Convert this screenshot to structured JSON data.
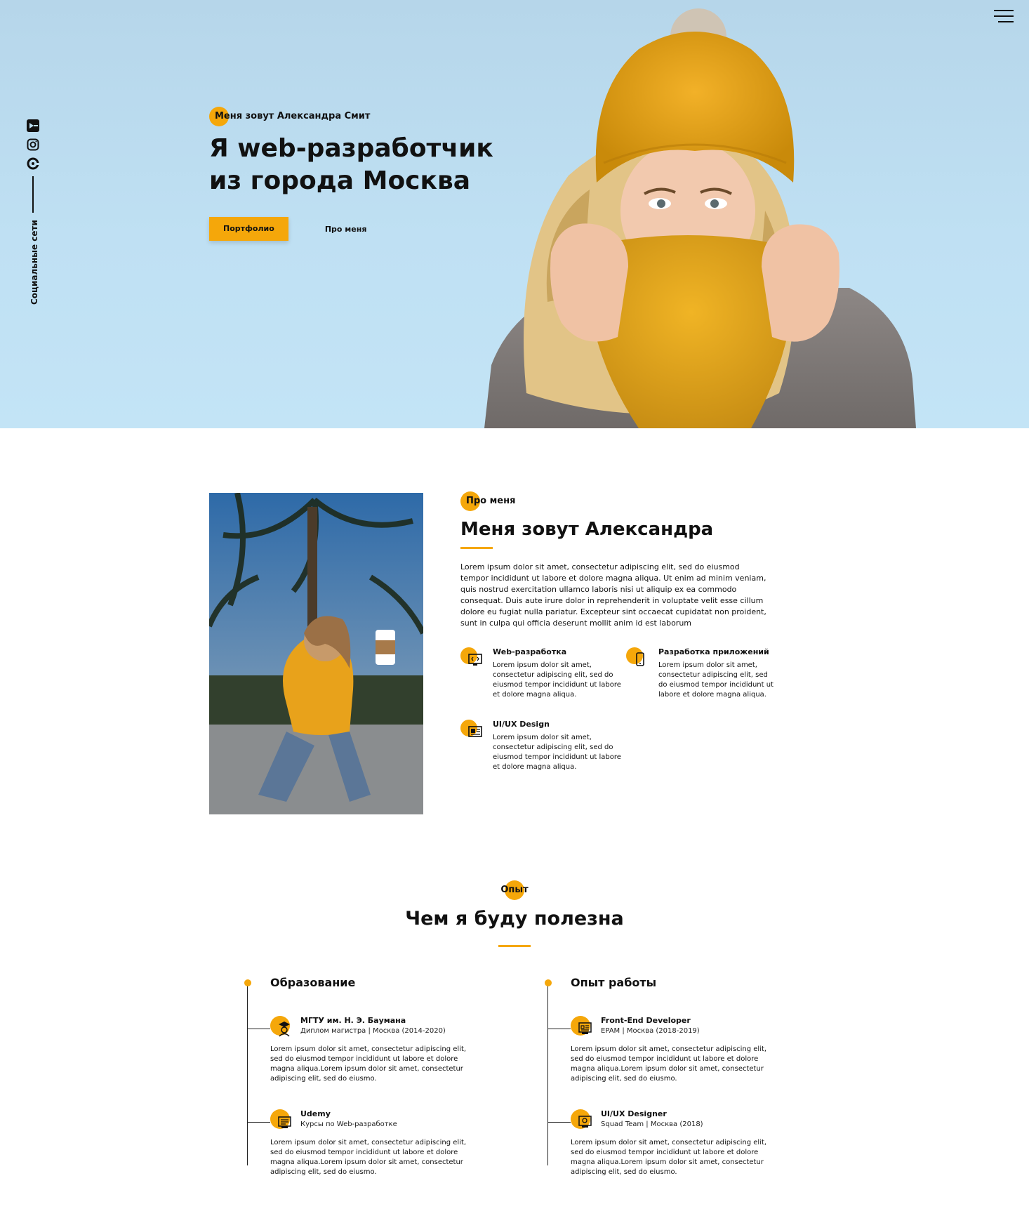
{
  "colors": {
    "accent": "#f5a70a",
    "hero_bg": "#bfe0f3",
    "text": "#111111"
  },
  "hero": {
    "kicker": "Меня зовут Александра Смит",
    "title_line1": "Я web-разработчик",
    "title_line2": "из города Москва",
    "btn_portfolio": "Портфолио",
    "btn_about": "Про меня",
    "social_label": "Социальные сети",
    "social_icons": [
      "youtube-icon",
      "instagram-icon",
      "github-icon"
    ],
    "menu_icon": "hamburger-menu-icon"
  },
  "about": {
    "kicker": "Про меня",
    "title": "Меня зовут Александра",
    "text": "Lorem ipsum dolor sit amet, consectetur adipiscing elit, sed do eiusmod tempor incididunt ut labore et dolore magna aliqua. Ut enim ad minim veniam, quis nostrud exercitation ullamco laboris nisi ut aliquip ex ea commodo consequat. Duis aute irure dolor in reprehenderit in voluptate velit esse cillum dolore eu fugiat nulla pariatur. Excepteur sint occaecat cupidatat non proident, sunt in culpa qui officia deserunt mollit anim id est laborum",
    "services": [
      {
        "title": "Web-разработка",
        "text": "Lorem ipsum dolor sit amet, consectetur adipiscing elit, sed do eiusmod tempor incididunt ut labore et dolore magna aliqua.",
        "icon": "monitor-code-icon"
      },
      {
        "title": "Разработка приложений",
        "text": "Lorem ipsum dolor sit amet, consectetur adipiscing elit, sed do eiusmod tempor incididunt ut labore et dolore magna aliqua.",
        "icon": "smartphone-icon"
      },
      {
        "title": "UI/UX Design",
        "text": "Lorem ipsum dolor sit amet, consectetur adipiscing elit, sed do eiusmod tempor incididunt ut labore et dolore magna aliqua.",
        "icon": "design-icon"
      }
    ]
  },
  "experience": {
    "kicker": "Опыт",
    "title": "Чем я буду полезна",
    "education": {
      "title": "Образование",
      "items": [
        {
          "title": "МГТУ им. Н. Э. Баумана",
          "sub": "Диплом магистра | Москва (2014-2020)",
          "text": "Lorem ipsum dolor sit amet, consectetur adipiscing elit, sed do eiusmod tempor incididunt ut labore et dolore magna aliqua.Lorem ipsum dolor sit amet, consectetur adipiscing elit, sed do eiusmo.",
          "icon": "graduate-icon"
        },
        {
          "title": "Udemy",
          "sub": "Курсы по Web-разработке",
          "text": "Lorem ipsum dolor sit amet, consectetur adipiscing elit, sed do eiusmod tempor incididunt ut labore et dolore magna aliqua.Lorem ipsum dolor sit amet, consectetur adipiscing elit, sed do eiusmo.",
          "icon": "online-course-icon"
        }
      ]
    },
    "work": {
      "title": "Опыт работы",
      "items": [
        {
          "title": "Front-End Developer",
          "sub": "EPAM | Москва (2018-2019)",
          "text": "Lorem ipsum dolor sit amet, consectetur adipiscing elit, sed do eiusmod tempor incididunt ut labore et dolore magna aliqua.Lorem ipsum dolor sit amet, consectetur adipiscing elit, sed do eiusmo.",
          "icon": "developer-icon"
        },
        {
          "title": "UI/UX Designer",
          "sub": "Squad Team | Москва (2018)",
          "text": "Lorem ipsum dolor sit amet, consectetur adipiscing elit, sed do eiusmod tempor incididunt ut labore et dolore magna aliqua.Lorem ipsum dolor sit amet, consectetur adipiscing elit, sed do eiusmo.",
          "icon": "designer-icon"
        }
      ]
    }
  }
}
